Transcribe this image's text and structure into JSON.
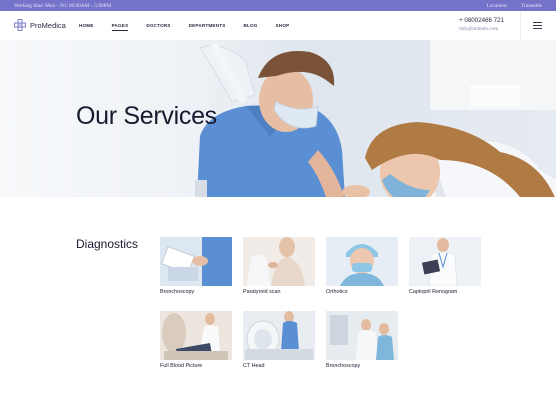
{
  "topbar": {
    "hours": "Working time: Mon – Fri: 09:00AM – 5:00PM",
    "links": [
      "Locations",
      "Timetable"
    ]
  },
  "header": {
    "logo_text": "ProMedica",
    "nav": [
      "HOME",
      "PAGES",
      "DOCTORS",
      "DEPARTMENTS",
      "BLOG",
      "SHOP"
    ],
    "active_nav": "PAGES",
    "phone": "+ 08002466 721",
    "email": "info@mdmdo.com"
  },
  "hero": {
    "title": "Our Services"
  },
  "section": {
    "title": "Diagnostics",
    "services": [
      {
        "label": "Bronchoscopy"
      },
      {
        "label": "Paratyroid scan"
      },
      {
        "label": "Orthotics"
      },
      {
        "label": "Captopril Renogram"
      },
      {
        "label": "Full Blood Picture"
      },
      {
        "label": "CT Head"
      },
      {
        "label": "Bronchoscopy"
      }
    ]
  },
  "colors": {
    "accent": "#7472c9",
    "scrubs": "#5b8fd4",
    "text": "#1a1a2e"
  },
  "icons": {
    "logo": "medical-cross-icon",
    "menu": "hamburger-menu-icon"
  }
}
